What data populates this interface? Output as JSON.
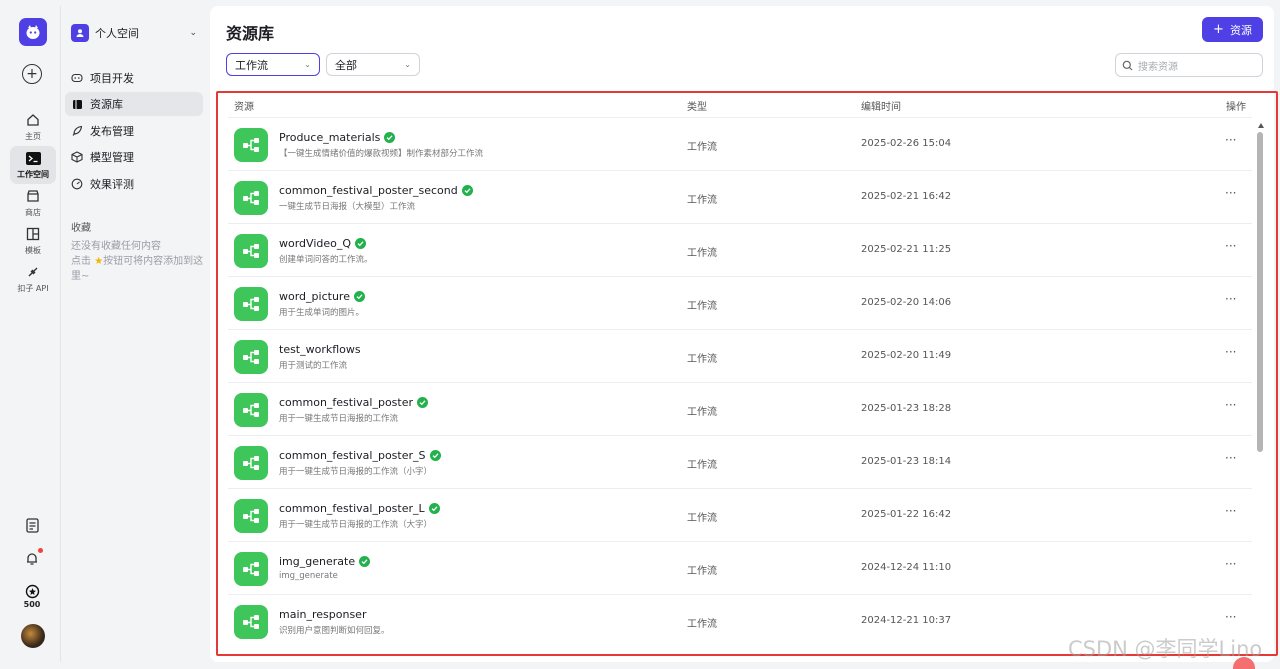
{
  "rail": {
    "items": [
      {
        "label": "主页",
        "icon": "home-icon"
      },
      {
        "label": "工作空间",
        "icon": "terminal-icon"
      },
      {
        "label": "商店",
        "icon": "store-icon"
      },
      {
        "label": "模板",
        "icon": "layout-icon"
      },
      {
        "label": "扣子 API",
        "icon": "plug-icon"
      }
    ],
    "credits": "500"
  },
  "sidebar": {
    "space_name": "个人空间",
    "nav": [
      {
        "label": "项目开发",
        "icon": "gamepad-icon"
      },
      {
        "label": "资源库",
        "icon": "book-icon"
      },
      {
        "label": "发布管理",
        "icon": "rocket-icon"
      },
      {
        "label": "模型管理",
        "icon": "cube-icon"
      },
      {
        "label": "效果评测",
        "icon": "gauge-icon"
      }
    ],
    "favorites_title": "收藏",
    "favorites_empty_line1": "还没有收藏任何内容",
    "favorites_empty_line2a": "点击",
    "favorites_empty_line2b": "按钮可将内容添加到这里~"
  },
  "main": {
    "title": "资源库",
    "add_button": "资源",
    "filter_type": "工作流",
    "filter_scope": "全部",
    "search_placeholder": "搜索资源",
    "columns": {
      "resource": "资源",
      "type": "类型",
      "edited": "编辑时间",
      "actions": "操作"
    },
    "rows": [
      {
        "name": "Produce_materials",
        "desc": "【一键生成情绪价值的爆款视频】制作素材部分工作流",
        "type": "工作流",
        "time": "2025-02-26 15:04",
        "verified": true
      },
      {
        "name": "common_festival_poster_second",
        "desc": "一键生成节日海报（大模型）工作流",
        "type": "工作流",
        "time": "2025-02-21 16:42",
        "verified": true
      },
      {
        "name": "wordVideo_Q",
        "desc": "创建单词问答的工作流。",
        "type": "工作流",
        "time": "2025-02-21 11:25",
        "verified": true
      },
      {
        "name": "word_picture",
        "desc": "用于生成单词的图片。",
        "type": "工作流",
        "time": "2025-02-20 14:06",
        "verified": true
      },
      {
        "name": "test_workflows",
        "desc": "用于测试的工作流",
        "type": "工作流",
        "time": "2025-02-20 11:49",
        "verified": false
      },
      {
        "name": "common_festival_poster",
        "desc": "用于一键生成节日海报的工作流",
        "type": "工作流",
        "time": "2025-01-23 18:28",
        "verified": true
      },
      {
        "name": "common_festival_poster_S",
        "desc": "用于一键生成节日海报的工作流（小字）",
        "type": "工作流",
        "time": "2025-01-23 18:14",
        "verified": true
      },
      {
        "name": "common_festival_poster_L",
        "desc": "用于一键生成节日海报的工作流（大字）",
        "type": "工作流",
        "time": "2025-01-22 16:42",
        "verified": true
      },
      {
        "name": "img_generate",
        "desc": "img_generate",
        "type": "工作流",
        "time": "2024-12-24 11:10",
        "verified": true
      },
      {
        "name": "main_responser",
        "desc": "识别用户意图判断如何回复。",
        "type": "工作流",
        "time": "2024-12-21 10:37",
        "verified": false
      }
    ]
  },
  "watermark": "CSDN @李同学Lino",
  "colors": {
    "accent": "#4e40e5",
    "workflow_icon": "#3ec65a",
    "highlight_border": "#e53935"
  }
}
